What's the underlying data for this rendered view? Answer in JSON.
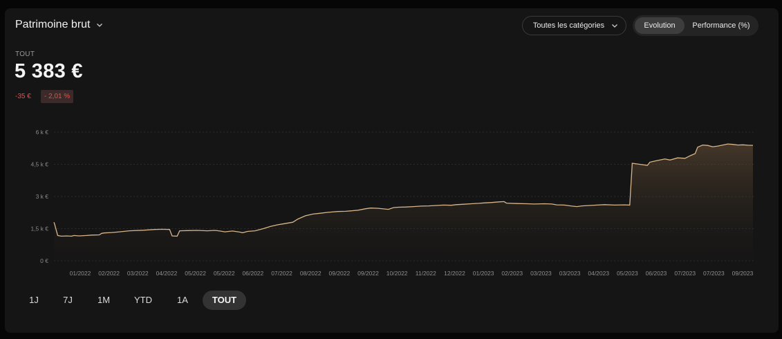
{
  "header": {
    "title": "Patrimoine brut",
    "category_select": "Toutes les catégories",
    "view_toggle": [
      "Evolution",
      "Performance (%)"
    ],
    "active_view": "Evolution"
  },
  "kpi": {
    "label": "TOUT",
    "value": "5 383 €",
    "delta_abs": "-35 €",
    "delta_pct": "- 2,01 %"
  },
  "colors": {
    "line": "#d9b68a",
    "negative": "#e0534c",
    "background": "#151515"
  },
  "periods": [
    "1J",
    "7J",
    "1M",
    "YTD",
    "1A",
    "TOUT"
  ],
  "active_period": "TOUT",
  "chart_data": {
    "type": "area",
    "ylim": [
      0,
      6000
    ],
    "yticks": [
      0,
      1500,
      3000,
      4500,
      6000
    ],
    "ytick_labels": [
      "0 €",
      "1,5 k €",
      "3 k €",
      "4,5 k €",
      "6 k €"
    ],
    "xtick_labels": [
      "01/2022",
      "02/2022",
      "03/2022",
      "04/2022",
      "05/2022",
      "05/2022",
      "06/2022",
      "07/2022",
      "08/2022",
      "09/2022",
      "09/2022",
      "10/2022",
      "11/2022",
      "12/2022",
      "01/2023",
      "02/2023",
      "03/2023",
      "03/2023",
      "04/2023",
      "05/2023",
      "06/2023",
      "07/2023",
      "07/2023",
      "09/2023"
    ],
    "grid": true,
    "series": [
      {
        "points": [
          [
            0,
            1800
          ],
          [
            0.3,
            1700
          ],
          [
            1,
            1400
          ],
          [
            1.5,
            1180
          ],
          [
            3,
            1150
          ],
          [
            5,
            1160
          ],
          [
            7,
            1150
          ],
          [
            8,
            1180
          ],
          [
            10,
            1160
          ],
          [
            13,
            1180
          ],
          [
            15,
            1200
          ],
          [
            18,
            1210
          ],
          [
            19,
            1280
          ],
          [
            20,
            1300
          ],
          [
            23,
            1320
          ],
          [
            26,
            1350
          ],
          [
            30,
            1400
          ],
          [
            36,
            1430
          ],
          [
            40,
            1460
          ],
          [
            43,
            1470
          ],
          [
            46,
            1460
          ],
          [
            47,
            1160
          ],
          [
            49,
            1150
          ],
          [
            50,
            1400
          ],
          [
            53,
            1410
          ],
          [
            57,
            1420
          ],
          [
            61,
            1400
          ],
          [
            64,
            1420
          ],
          [
            66,
            1390
          ],
          [
            68,
            1350
          ],
          [
            71,
            1390
          ],
          [
            74,
            1340
          ],
          [
            75,
            1310
          ],
          [
            77,
            1370
          ],
          [
            80,
            1400
          ],
          [
            83,
            1490
          ],
          [
            86,
            1600
          ],
          [
            89,
            1680
          ],
          [
            91,
            1720
          ],
          [
            95,
            1800
          ],
          [
            97,
            1950
          ],
          [
            100,
            2100
          ],
          [
            103,
            2180
          ],
          [
            106,
            2220
          ],
          [
            109,
            2260
          ],
          [
            113,
            2300
          ],
          [
            116,
            2310
          ],
          [
            118,
            2330
          ],
          [
            121,
            2360
          ],
          [
            124,
            2430
          ],
          [
            126,
            2460
          ],
          [
            129,
            2450
          ],
          [
            133,
            2400
          ],
          [
            135,
            2480
          ],
          [
            137,
            2500
          ],
          [
            140,
            2510
          ],
          [
            143,
            2530
          ],
          [
            146,
            2550
          ],
          [
            149,
            2560
          ],
          [
            152,
            2580
          ],
          [
            155,
            2600
          ],
          [
            158,
            2590
          ],
          [
            160,
            2620
          ],
          [
            163,
            2640
          ],
          [
            166,
            2660
          ],
          [
            169,
            2680
          ],
          [
            171,
            2700
          ],
          [
            174,
            2720
          ],
          [
            177,
            2750
          ],
          [
            179,
            2760
          ],
          [
            180,
            2690
          ],
          [
            184,
            2670
          ],
          [
            188,
            2660
          ],
          [
            191,
            2650
          ],
          [
            195,
            2660
          ],
          [
            198,
            2650
          ],
          [
            200,
            2610
          ],
          [
            203,
            2600
          ],
          [
            206,
            2550
          ],
          [
            208,
            2530
          ],
          [
            210,
            2560
          ],
          [
            213,
            2580
          ],
          [
            216,
            2600
          ],
          [
            219,
            2620
          ],
          [
            223,
            2600
          ],
          [
            227,
            2610
          ],
          [
            229,
            2600
          ],
          [
            230,
            4550
          ],
          [
            233,
            4500
          ],
          [
            236,
            4450
          ],
          [
            237,
            4600
          ],
          [
            239,
            4650
          ],
          [
            241,
            4700
          ],
          [
            243,
            4750
          ],
          [
            245,
            4700
          ],
          [
            248,
            4800
          ],
          [
            251,
            4780
          ],
          [
            253,
            4900
          ],
          [
            255,
            5000
          ],
          [
            256,
            5300
          ],
          [
            258,
            5400
          ],
          [
            260,
            5380
          ],
          [
            262,
            5320
          ],
          [
            264,
            5350
          ],
          [
            266,
            5400
          ],
          [
            268,
            5450
          ],
          [
            270,
            5430
          ],
          [
            272,
            5400
          ],
          [
            274,
            5410
          ],
          [
            276,
            5390
          ],
          [
            278,
            5383
          ]
        ]
      }
    ]
  }
}
